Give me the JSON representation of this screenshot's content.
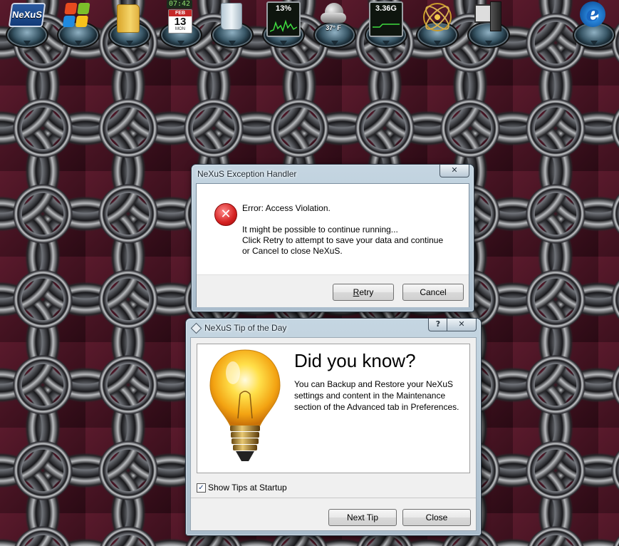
{
  "dock": {
    "items": [
      {
        "name": "nexus-logo-icon",
        "label": "NeXuS"
      },
      {
        "name": "windows-start-icon"
      },
      {
        "name": "folder-icon"
      },
      {
        "name": "calendar-icon",
        "clock": "07:42",
        "month": "FEB",
        "day": "13",
        "weekday": "MON"
      },
      {
        "name": "recycle-bin-icon"
      },
      {
        "name": "cpu-meter-icon",
        "value": "13%"
      },
      {
        "name": "weather-icon",
        "temperature": "37° F"
      },
      {
        "name": "memory-meter-icon",
        "value": "3.36G"
      },
      {
        "name": "atom-icon"
      },
      {
        "name": "computer-icon"
      },
      {
        "name": "internet-explorer-icon",
        "glyph": "e"
      }
    ]
  },
  "error_dialog": {
    "title": "NeXuS Exception Handler",
    "close_glyph": "✕",
    "error_glyph": "✕",
    "message_line1": "Error: Access Violation.",
    "message_line2": "It might be possible to continue running...",
    "message_line3": "Click Retry to attempt to save your data and continue",
    "message_line4": "or Cancel to close NeXuS.",
    "retry_label_underlined": "R",
    "retry_label_rest": "etry",
    "cancel_label": "Cancel"
  },
  "tip_dialog": {
    "title": "NeXuS Tip of the Day",
    "help_glyph": "?",
    "close_glyph": "✕",
    "heading": "Did you know?",
    "body": "You can Backup and Restore your NeXuS settings and content in the Maintenance section of the Advanced tab in Preferences.",
    "show_tips_checked": true,
    "check_glyph": "✓",
    "show_tips_label": "Show Tips at Startup",
    "next_tip_label": "Next Tip",
    "close_label": "Close"
  }
}
